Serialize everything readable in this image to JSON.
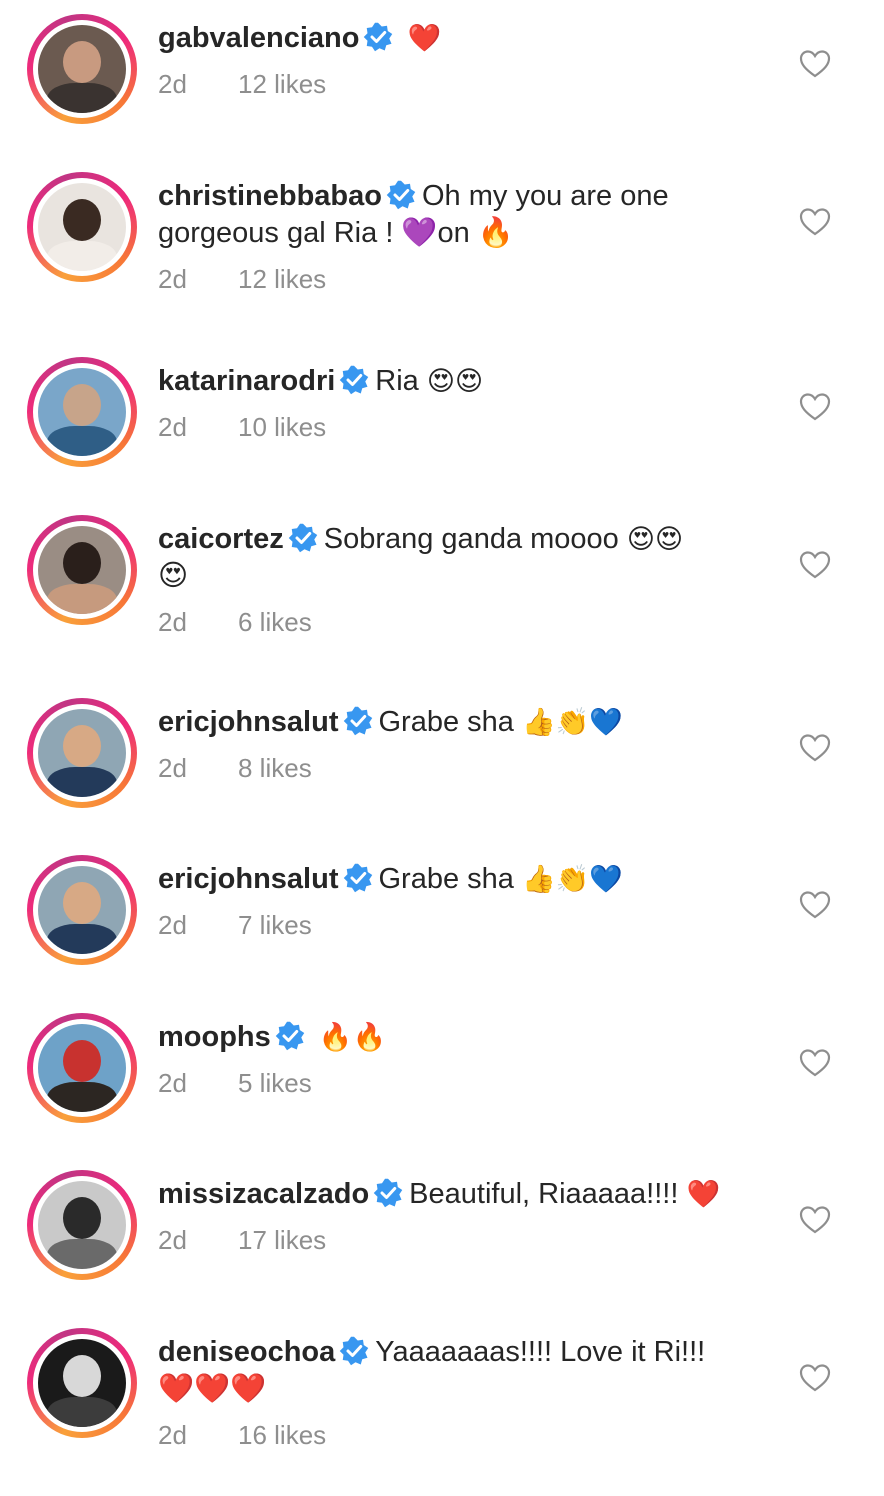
{
  "comments": [
    {
      "username": "gabvalenciano",
      "text": "",
      "emoji": "❤️",
      "line2": "",
      "time": "2d",
      "likes": "12 likes",
      "avatar_colors": [
        "#6b5a50",
        "#c89a80",
        "#3a3330"
      ]
    },
    {
      "username": "christinebbabao",
      "text": "Oh my you are one",
      "emoji": "",
      "line2": "gorgeous gal Ria ! 💜on 🔥",
      "time": "2d",
      "likes": "12 likes",
      "avatar_colors": [
        "#e9e4df",
        "#3a2a22",
        "#f2ede8"
      ]
    },
    {
      "username": "katarinarodri",
      "text": "Ria",
      "emoji": "😍😍",
      "line2": "",
      "time": "2d",
      "likes": "10 likes",
      "avatar_colors": [
        "#7aa6c9",
        "#c7a48a",
        "#2f5e86"
      ]
    },
    {
      "username": "caicortez",
      "text": "Sobrang ganda moooo",
      "emoji": "😍😍",
      "line2": "😍",
      "time": "2d",
      "likes": "6 likes",
      "avatar_colors": [
        "#9a8d84",
        "#2a1f1b",
        "#c69a7e"
      ]
    },
    {
      "username": "ericjohnsalut",
      "text": "Grabe sha",
      "emoji": "👍👏💙",
      "line2": "",
      "time": "2d",
      "likes": "8 likes",
      "avatar_colors": [
        "#8fa6b4",
        "#d7a985",
        "#233a5a"
      ]
    },
    {
      "username": "ericjohnsalut",
      "text": "Grabe sha",
      "emoji": "👍👏💙",
      "line2": "",
      "time": "2d",
      "likes": "7 likes",
      "avatar_colors": [
        "#8fa6b4",
        "#d7a985",
        "#233a5a"
      ]
    },
    {
      "username": "moophs",
      "text": "",
      "emoji": "🔥🔥",
      "line2": "",
      "time": "2d",
      "likes": "5 likes",
      "avatar_colors": [
        "#6ea2c8",
        "#c8322f",
        "#2c2622"
      ]
    },
    {
      "username": "missizacalzado",
      "text": "Beautiful, Riaaaaa!!!!",
      "emoji": "❤️",
      "line2": "",
      "time": "2d",
      "likes": "17 likes",
      "avatar_colors": [
        "#c9c9c9",
        "#2a2a2a",
        "#6a6a6a"
      ]
    },
    {
      "username": "deniseochoa",
      "text": "Yaaaaaaas!!!! Love it Ri!!!",
      "emoji": "",
      "line2": "❤️❤️❤️",
      "time": "2d",
      "likes": "16 likes",
      "avatar_colors": [
        "#1a1a1a",
        "#d8d8d8",
        "#3c3c3c"
      ]
    }
  ]
}
